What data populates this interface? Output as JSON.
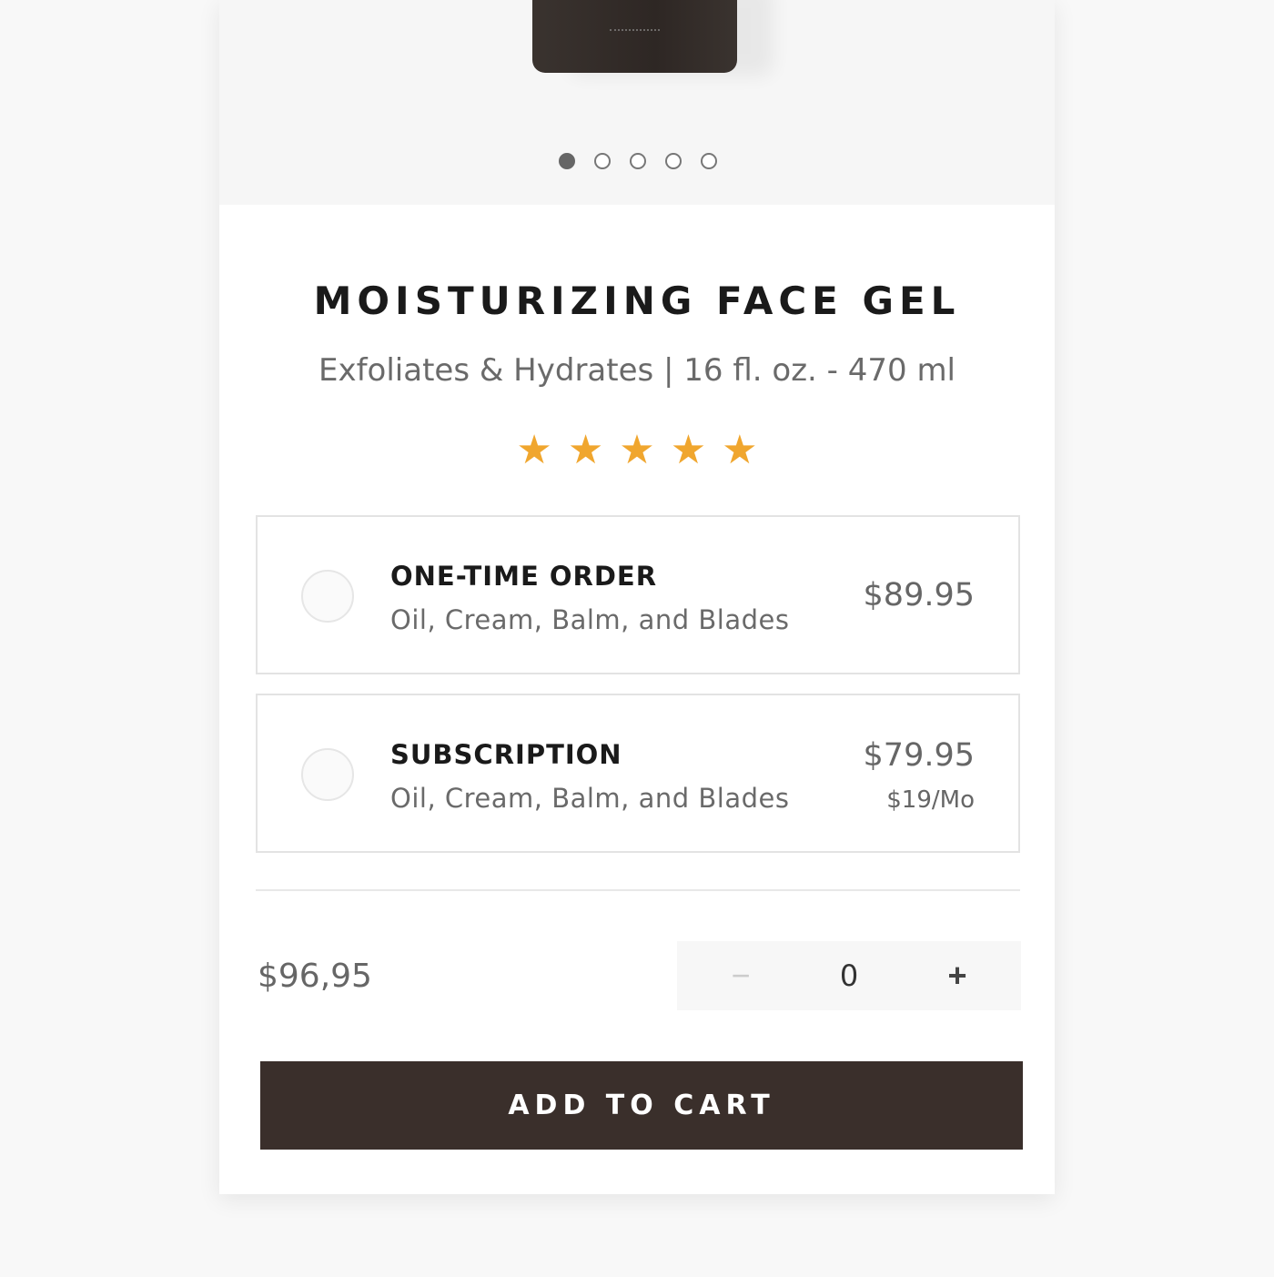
{
  "gallery": {
    "dots": 5,
    "active_index": 0
  },
  "product": {
    "title": "MOISTURIZING FACE GEL",
    "subtitle": "Exfoliates & Hydrates | 16 fl. oz. - 470 ml",
    "rating": 5,
    "rating_max": 5,
    "star_color": "#f0a62e"
  },
  "options": [
    {
      "title": "ONE-TIME ORDER",
      "description": "Oil, Cream, Balm, and Blades",
      "price": "$89.95",
      "selected": false
    },
    {
      "title": "SUBSCRIPTION",
      "description": "Oil, Cream, Balm, and Blades",
      "price": "$79.95",
      "monthly": "$19/Mo",
      "selected": false
    }
  ],
  "total": "$96,95",
  "quantity": {
    "minus": "−",
    "value": "0",
    "plus": "+"
  },
  "cart": {
    "label": "ADD TO CART",
    "color": "#3a2f2b"
  }
}
